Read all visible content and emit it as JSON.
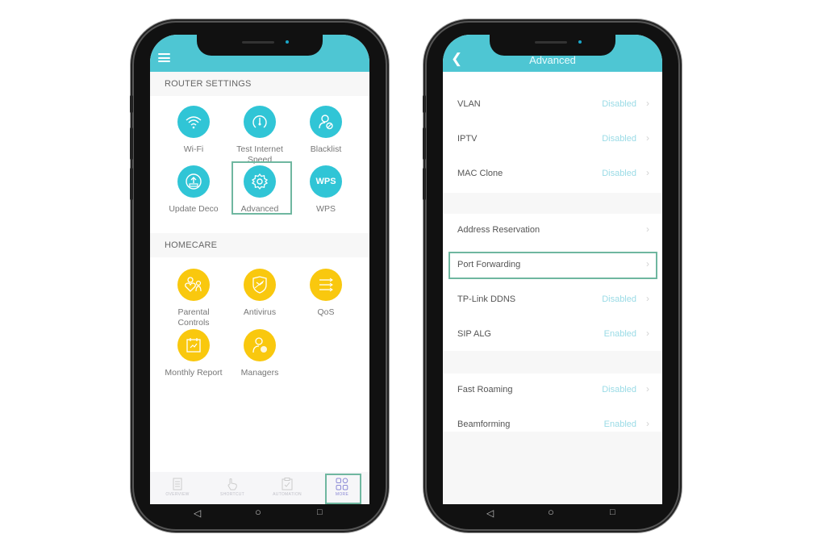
{
  "left_phone": {
    "menu_icon": "hamburger-icon",
    "router_settings": {
      "header": "ROUTER SETTINGS",
      "tiles": [
        {
          "label": "Wi-Fi",
          "icon": "wifi-icon"
        },
        {
          "label": "Test Internet Speed",
          "icon": "speedometer-icon"
        },
        {
          "label": "Blacklist",
          "icon": "blocked-user-icon"
        },
        {
          "label": "Update Deco",
          "icon": "upload-icon"
        },
        {
          "label": "Advanced",
          "icon": "gear-icon",
          "highlighted": true
        },
        {
          "label": "WPS",
          "icon": "wps-icon",
          "glyph": "WPS"
        }
      ]
    },
    "homecare": {
      "header": "HOMECARE",
      "tiles": [
        {
          "label": "Parental Controls",
          "icon": "parental-controls-icon"
        },
        {
          "label": "Antivirus",
          "icon": "shield-icon"
        },
        {
          "label": "QoS",
          "icon": "qos-icon"
        },
        {
          "label": "Monthly Report",
          "icon": "calendar-report-icon"
        },
        {
          "label": "Managers",
          "icon": "manager-icon"
        }
      ]
    },
    "tabbar": [
      {
        "label": "OVERVIEW",
        "icon": "document-icon"
      },
      {
        "label": "SHORTCUT",
        "icon": "hand-tap-icon"
      },
      {
        "label": "AUTOMATION",
        "icon": "clipboard-check-icon"
      },
      {
        "label": "MORE",
        "icon": "grid-icon",
        "active": true
      }
    ]
  },
  "right_phone": {
    "title": "Advanced",
    "back_icon": "chevron-left-icon",
    "groups": [
      [
        {
          "label": "VLAN",
          "value": "Disabled"
        },
        {
          "label": "IPTV",
          "value": "Disabled"
        },
        {
          "label": "MAC Clone",
          "value": "Disabled"
        }
      ],
      [
        {
          "label": "Address Reservation",
          "value": ""
        },
        {
          "label": "Port Forwarding",
          "value": "",
          "highlighted": true
        },
        {
          "label": "TP-Link DDNS",
          "value": "Disabled"
        },
        {
          "label": "SIP ALG",
          "value": "Enabled"
        }
      ],
      [
        {
          "label": "Fast Roaming",
          "value": "Disabled"
        },
        {
          "label": "Beamforming",
          "value": "Enabled"
        }
      ]
    ]
  },
  "colors": {
    "app_bar": "#4ec6d3",
    "teal_icon": "#30c5d6",
    "yellow_icon": "#f9c80e",
    "highlight_border": "#6fb7a0",
    "status_value": "#9adbe6",
    "active_tab": "#8c8ad6"
  }
}
